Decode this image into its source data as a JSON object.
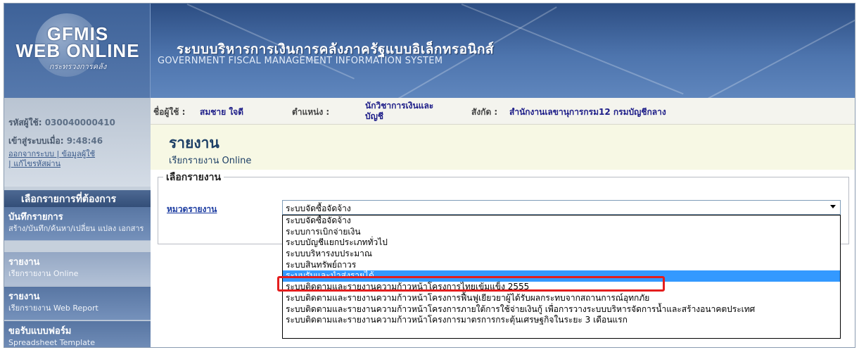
{
  "header": {
    "logo_line1": "GFMIS",
    "logo_line2": "WEB ONLINE",
    "logo_line3": "กระทรวงการคลัง",
    "title_thai": "ระบบบริหารการเงินการคลังภาครัฐแบบอิเล็กทรอนิกส์",
    "title_eng": "GOVERNMENT FISCAL MANAGEMENT INFORMATION SYSTEM"
  },
  "user": {
    "id_label": "รหัสผู้ใช้:",
    "id_value": "030040000410",
    "login_label": "เข้าสู่ระบบเมื่อ:",
    "login_value": "9:48:46",
    "link_logout": "ออกจากระบบ",
    "link_userinfo": "ข้อมูลผู้ใช้",
    "link_password": "แก้ไขรหัสผ่าน",
    "sep": "|"
  },
  "info_bar": {
    "user_label": "ชื่อผู้ใช้ :",
    "user_value": "สมชาย ใจดี",
    "pos_label": "ตำแหน่ง :",
    "pos_line1": "นักวิชาการเงินและ",
    "pos_line2": "บัญชี",
    "dept_label": "สังกัด :",
    "dept_value": "สำนักงานเลขานุการกรม12 กรมบัญชีกลาง"
  },
  "sidebar": {
    "menu_header": "เลือกรายการที่ต้องการ",
    "items": [
      {
        "title": "บันทึกรายการ",
        "sub": "สร้าง/บันทึก/ค้นหา/เปลี่ยน แปลง เอกสาร"
      },
      {
        "title": "รายงาน",
        "sub": "เรียกรายงาน Online"
      },
      {
        "title": "รายงาน",
        "sub": "เรียกรายงาน Web Report"
      },
      {
        "title": "ขอรับแบบฟอร์ม",
        "sub": "Spreadsheet Template"
      }
    ]
  },
  "report": {
    "title": "รายงาน",
    "subtitle": "เรียกรายงาน Online",
    "legend": "เลือกรายงาน",
    "category_label": "หมวดรายงาน",
    "selected": "ระบบจัดซื้อจัดจ้าง",
    "options": [
      "ระบบจัดซื้อจัดจ้าง",
      "ระบบการเบิกจ่ายเงิน",
      "ระบบบัญชีแยกประเภททั่วไป",
      "ระบบบริหารงบประมาณ",
      "ระบบสินทรัพย์ถาวร",
      "ระบบรับและนำส่งรายได้",
      "ระบบติดตามและรายงานความก้าวหน้าโครงการไทยเข้มแข็ง 2555",
      "ระบบติดตามและรายงานความก้าวหน้าโครงการฟื้นฟูเยียวยาผู้ได้รับผลกระทบจากสถานการณ์อุทกภัย",
      "ระบบติดตามและรายงานความก้าวหน้าโครงการภายใต้การใช้จ่ายเงินกู้ เพื่อการวางระบบบริหารจัดการน้ำและสร้างอนาคตประเทศ",
      "ระบบติดตามและรายงานความก้าวหน้าโครงการมาตรการกระตุ้นเศรษฐกิจในระยะ 3 เดือนแรก"
    ],
    "highlighted_index": 5
  },
  "colors": {
    "header_bg": "#3e6298",
    "menu_bg": "#5876a3",
    "highlight_red": "#e41e1e",
    "option_select": "#3399ff"
  }
}
